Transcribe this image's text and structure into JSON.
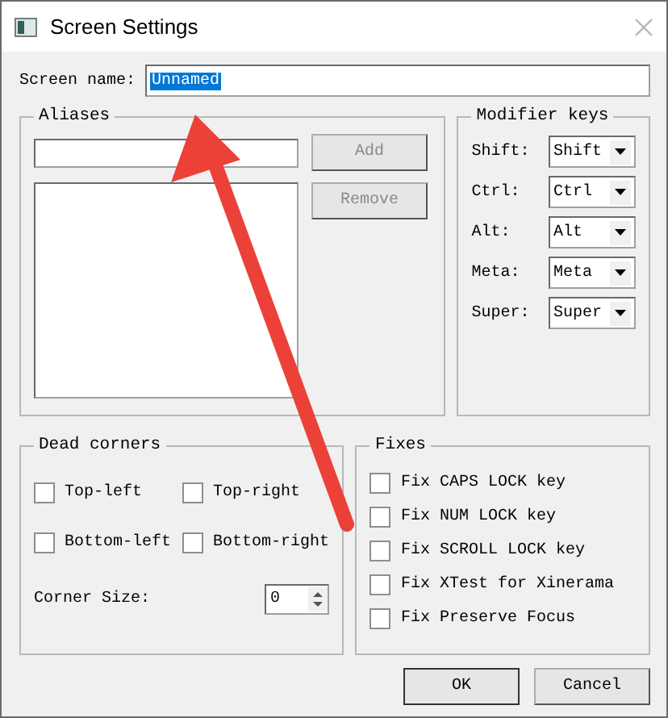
{
  "window": {
    "title": "Screen Settings"
  },
  "screen_name": {
    "label": "Screen name:",
    "value": "Unnamed",
    "selected": true
  },
  "aliases": {
    "title": "Aliases",
    "buttons": [
      {
        "label": "Add",
        "disabled": true
      },
      {
        "label": "Remove",
        "disabled": true
      }
    ]
  },
  "modifier_keys": {
    "title": "Modifier keys",
    "rows": [
      {
        "label": "Shift:",
        "value": "Shift"
      },
      {
        "label": "Ctrl:",
        "value": "Ctrl"
      },
      {
        "label": "Alt:",
        "value": "Alt"
      },
      {
        "label": "Meta:",
        "value": "Meta"
      },
      {
        "label": "Super:",
        "value": "Super"
      }
    ]
  },
  "dead_corners": {
    "title": "Dead corners",
    "corners": [
      {
        "label": "Top-left",
        "checked": false
      },
      {
        "label": "Top-right",
        "checked": false
      },
      {
        "label": "Bottom-left",
        "checked": false
      },
      {
        "label": "Bottom-right",
        "checked": false
      }
    ],
    "corner_size": {
      "label": "Corner Size:",
      "value": "0"
    }
  },
  "fixes": {
    "title": "Fixes",
    "items": [
      {
        "label": "Fix CAPS LOCK key",
        "checked": false
      },
      {
        "label": "Fix NUM LOCK key",
        "checked": false
      },
      {
        "label": "Fix SCROLL LOCK key",
        "checked": false
      },
      {
        "label": "Fix XTest for Xinerama",
        "checked": false
      },
      {
        "label": "Fix Preserve Focus",
        "checked": false
      }
    ]
  },
  "buttons": [
    {
      "label": "OK",
      "default": true
    },
    {
      "label": "Cancel",
      "default": false
    }
  ],
  "annotation": {
    "kind": "arrow"
  }
}
